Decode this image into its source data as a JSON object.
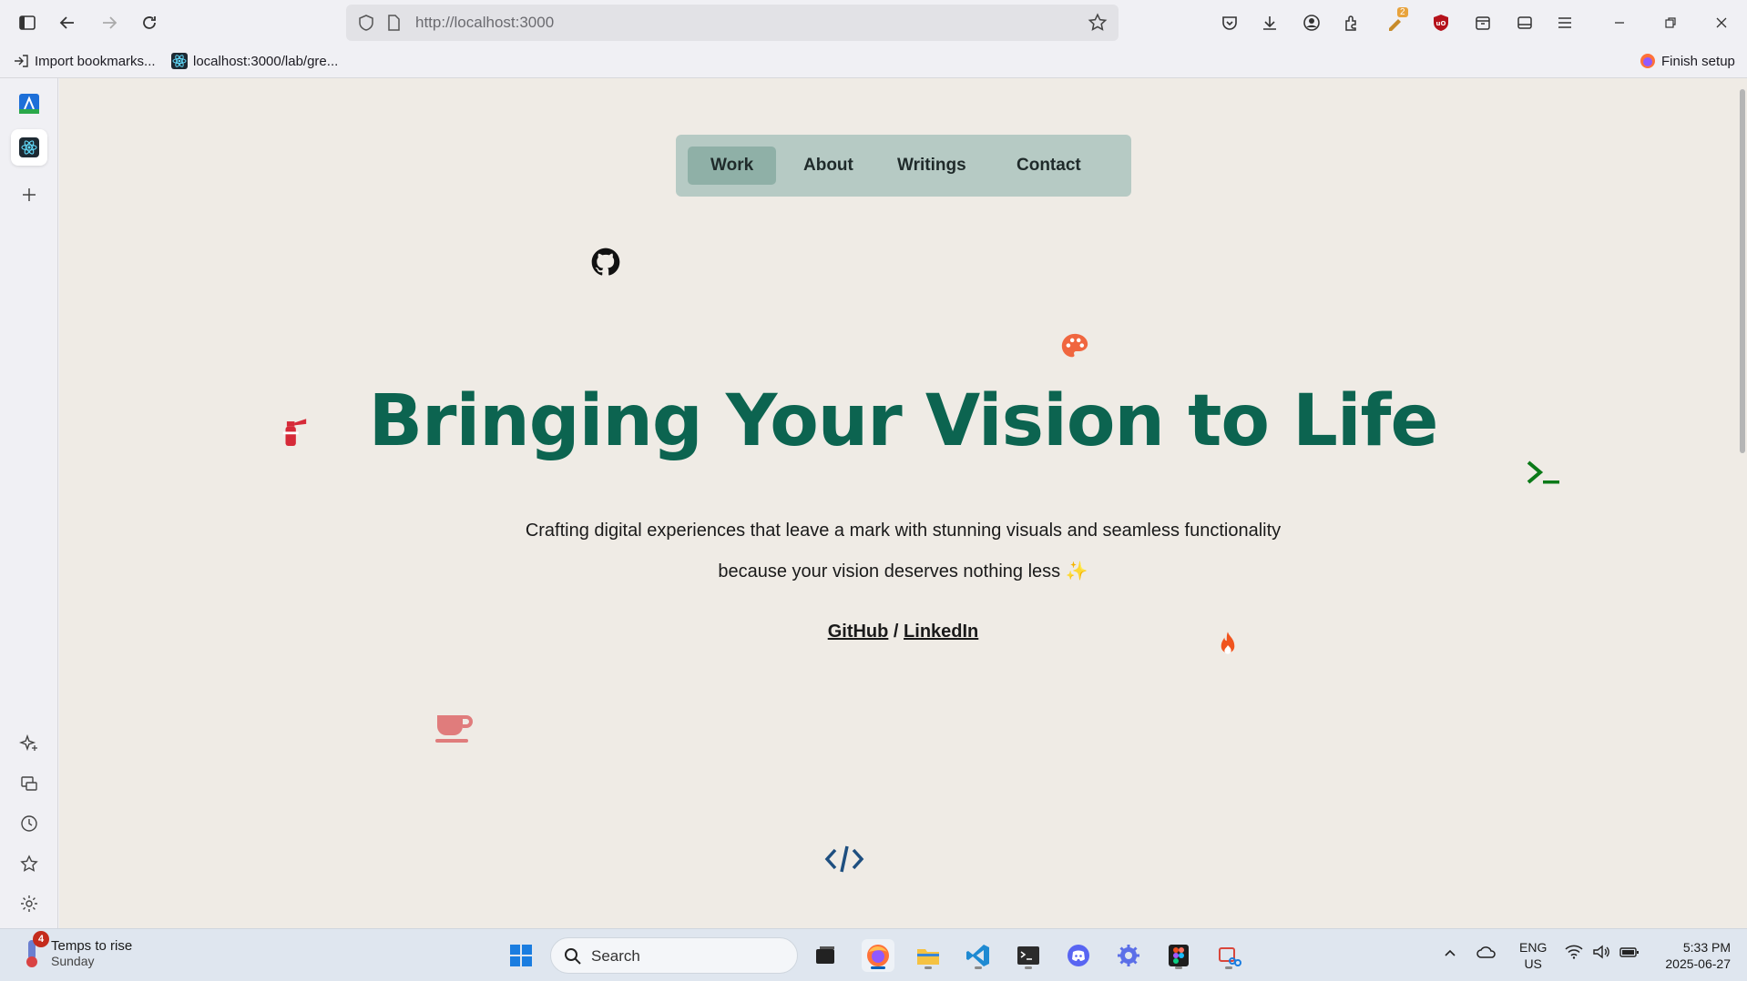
{
  "browser": {
    "url": "http://localhost:3000",
    "bookmarks": [
      {
        "label": "Import bookmarks..."
      },
      {
        "label": "localhost:3000/lab/gre..."
      }
    ],
    "finish_setup": "Finish setup",
    "extension_badge": "2"
  },
  "nav": {
    "items": [
      "Work",
      "About",
      "Writings",
      "Contact"
    ],
    "active": "Work"
  },
  "hero": {
    "title": "Bringing Your Vision to Life",
    "subtitle_line1": "Crafting digital experiences that leave a mark with stunning visuals and seamless functionality",
    "subtitle_line2": "because your vision deserves nothing less ✨",
    "link_github": "GitHub",
    "link_separator": " / ",
    "link_linkedin": "LinkedIn"
  },
  "floating_icons": [
    "github-icon",
    "palette-icon",
    "fire-extinguisher-icon",
    "terminal-icon",
    "fire-icon",
    "coffee-icon",
    "code-icon"
  ],
  "colors": {
    "title": "#0c6450",
    "nav_bg": "#b6cac4",
    "nav_active": "#8fb0a7",
    "page_bg": "#efebe5",
    "palette": "#f0663f",
    "extinguisher": "#d62a38",
    "terminal": "#0b7a18",
    "fire": "#f0541e",
    "coffee": "#e07c7c",
    "code": "#1e4f80"
  },
  "taskbar": {
    "weather_title": "Temps to rise",
    "weather_sub": "Sunday",
    "weather_badge": "4",
    "search_placeholder": "Search",
    "lang_line1": "ENG",
    "lang_line2": "US",
    "time": "5:33 PM",
    "date": "2025-06-27"
  }
}
